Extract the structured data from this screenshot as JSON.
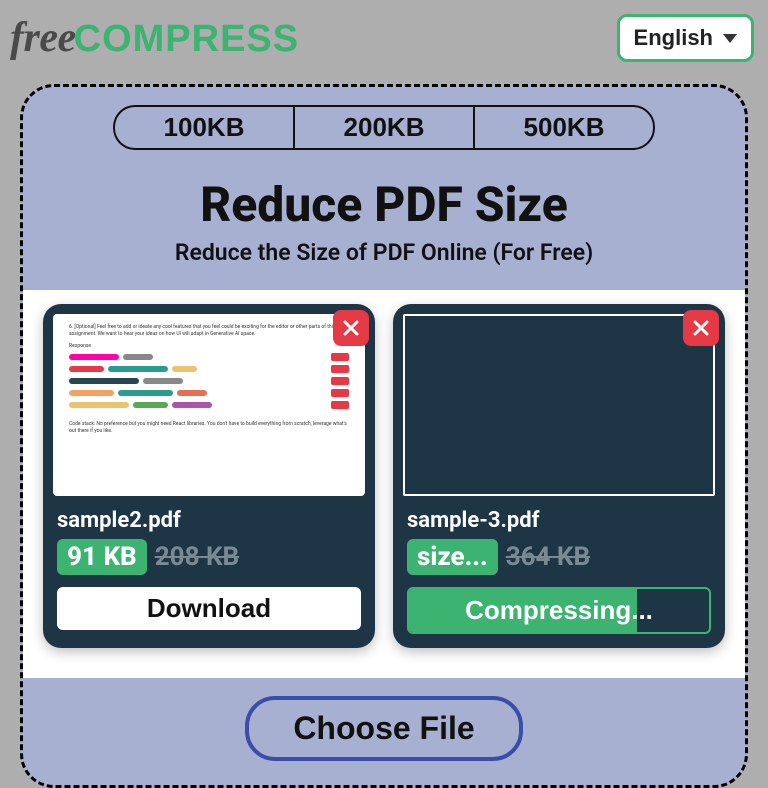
{
  "logo": {
    "free": "free",
    "compress": "COMPRESS"
  },
  "language": {
    "label": "English"
  },
  "presets": [
    "100KB",
    "200KB",
    "500KB"
  ],
  "title": "Reduce PDF Size",
  "subtitle": "Reduce the Size of PDF Online (For Free)",
  "files": [
    {
      "name": "sample2.pdf",
      "new_size": "91 KB",
      "old_size": "208 KB",
      "action": "Download",
      "state": "done"
    },
    {
      "name": "sample-3.pdf",
      "new_size": "size...",
      "old_size": "364 KB",
      "action": "Compressing...",
      "state": "progress"
    }
  ],
  "choose_label": "Choose File"
}
